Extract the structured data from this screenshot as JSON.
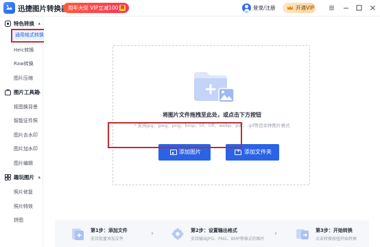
{
  "app": {
    "title": "迅捷图片转换器",
    "promo_text": "周年大促 VIP立减100元",
    "promo_tag": "惠",
    "login_label": "登录/注册",
    "vip_label": "开通VIP",
    "window_controls": [
      "menu-icon",
      "minimize-icon",
      "maximize-icon",
      "close-icon"
    ]
  },
  "sidebar": {
    "groups": [
      {
        "label": "特色转换",
        "icon": "star-shield-icon",
        "items": [
          "通用格式转换",
          "Heic转换",
          "Raw转换",
          "图片压缩"
        ]
      },
      {
        "label": "图片工具箱",
        "icon": "toolbox-icon",
        "items": [
          "抠图换背景",
          "智能证件照",
          "图片去水印",
          "图片加水印",
          "图片编辑"
        ]
      },
      {
        "label": "趣玩图片",
        "icon": "fun-icon",
        "items": [
          "照片修复",
          "照片特效",
          "拼图"
        ]
      }
    ],
    "active_item": "通用格式转换"
  },
  "main": {
    "drop_hint": "将图片文件拖拽至此处，或点击下方按钮",
    "support_hint": "* 支持jpg、jpeg、png、bmp、tif、tiff、webp、pdf、.gif等百余种图片格式",
    "add_image_label": "添加图片",
    "add_folder_label": "添加文件夹"
  },
  "steps": [
    {
      "title": "第1步：添加文件",
      "desc": "支持批量添加文件"
    },
    {
      "title": "第2步：设置输出格式",
      "desc": "支持输出JPG、PNG、BMP等格式的图片"
    },
    {
      "title": "第3步：开始转换",
      "desc": "点击转换按钮开始转换"
    }
  ],
  "colors": {
    "accent": "#2b63e6",
    "highlight_box": "#c7282d",
    "promo": "#f7375a",
    "vip": "#ffd59a"
  }
}
